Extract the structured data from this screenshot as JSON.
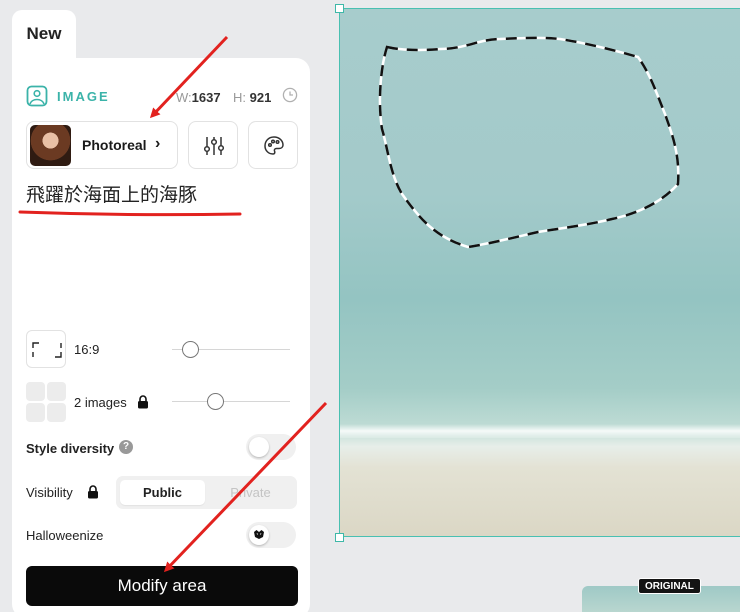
{
  "tab": {
    "label": "New"
  },
  "section": {
    "label": "IMAGE",
    "icon": "image-icon",
    "accent": "#3bb3a9"
  },
  "dimensions": {
    "w_label": "W:",
    "w_value": "1637",
    "h_label": "H:",
    "h_value": "921",
    "icon": "clock-icon"
  },
  "model": {
    "label": "Photoreal",
    "chevron": "›"
  },
  "tools": [
    {
      "icon": "sliders-icon"
    },
    {
      "icon": "palette-icon"
    }
  ],
  "prompt": {
    "text": "飛躍於海面上的海豚"
  },
  "aspect_ratio": {
    "label": "16:9",
    "slider_fraction": 0.15
  },
  "image_count": {
    "label": "2 images",
    "slider_fraction": 0.35
  },
  "style_diversity": {
    "label": "Style diversity",
    "help": "?",
    "enabled": false
  },
  "visibility": {
    "label": "Visibility",
    "options": [
      "Public",
      "Private"
    ],
    "selected": "Public"
  },
  "halloweenize": {
    "label": "Halloweenize",
    "enabled": false
  },
  "action": {
    "label": "Modify area"
  },
  "original_badge": {
    "label": "ORIGINAL"
  },
  "colors": {
    "accent": "#3bb3a9",
    "primary_button": "#0a0a0a",
    "annotation_red": "#e2221f"
  }
}
